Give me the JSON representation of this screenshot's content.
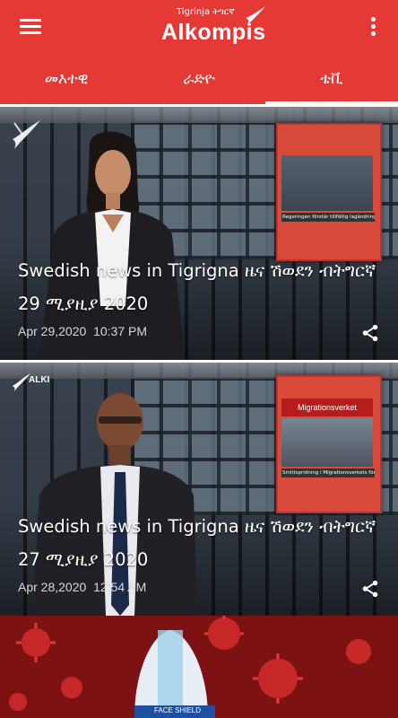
{
  "header": {
    "logo_subtitle": "Tigrinja ትግርኛ",
    "logo_title": "Alkompis",
    "menu_icon": "menu-icon",
    "more_icon": "more-vert-icon"
  },
  "tabs": [
    {
      "label": "መእተዊ",
      "active": false
    },
    {
      "label": "ራድዮ",
      "active": false
    },
    {
      "label": "ቴቪ",
      "active": true
    }
  ],
  "articles": [
    {
      "headline_line1": "Swedish news in Tigrigna ዜና ሽወደን ብትግርኛ",
      "headline_line2": "29 ሚያዚያ 2020",
      "date": "Apr 29,2020",
      "time": "10:37 PM",
      "inset_caption": "Regeringen förstär tillfällig lagändring",
      "share_icon": "share-icon"
    },
    {
      "headline_line1": "Swedish news in Tigrigna ዜና ሽወደን ብትግርኛ",
      "headline_line2": "27 ሚያዚያ 2020",
      "date": "Apr 28,2020",
      "time": "12:54 AM",
      "inset_title": "Migrationsverket",
      "inset_caption": "Smittspridning i Migrationsverkets förvar",
      "brand_text": "ALKI",
      "share_icon": "share-icon"
    },
    {
      "mask_text": "FACE SHIELD"
    }
  ],
  "colors": {
    "primary": "#e53935",
    "white": "#ffffff"
  }
}
